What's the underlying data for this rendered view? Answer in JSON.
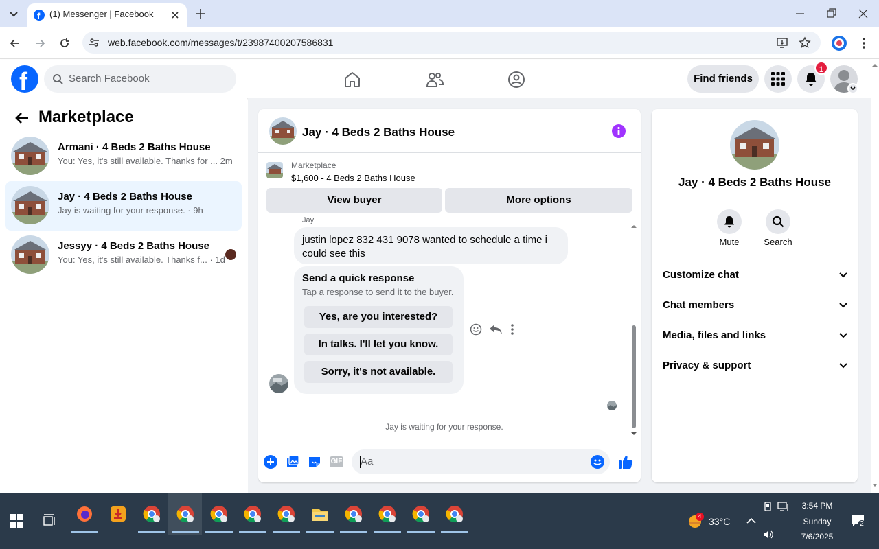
{
  "browser": {
    "tab_title": "(1) Messenger | Facebook",
    "url": "web.facebook.com/messages/t/23987400207586831"
  },
  "fb": {
    "search_placeholder": "Search Facebook",
    "find_friends": "Find friends",
    "notification_count": "1"
  },
  "sidebar": {
    "title": "Marketplace",
    "conversations": [
      {
        "name": "Armani · 4 Beds 2 Baths House",
        "preview": "You: Yes, it's still available. Thanks for ...",
        "time": "2m",
        "selected": false
      },
      {
        "name": "Jay · 4 Beds 2 Baths House",
        "preview": "Jay is waiting for your response. · 9h",
        "time": "",
        "selected": true
      },
      {
        "name": "Jessyy · 4 Beds 2 Baths House",
        "preview": "You: Yes, it's still available. Thanks f... · 1d",
        "time": "",
        "selected": false
      }
    ]
  },
  "chat": {
    "title": "Jay · 4 Beds 2 Baths House",
    "listing_label": "Marketplace",
    "listing_detail": "$1,600 - 4 Beds 2 Baths House",
    "view_buyer": "View buyer",
    "more_options": "More options",
    "sender_label": "Jay",
    "message": "justin lopez 832 431 9078 wanted to schedule a time i could see this",
    "quick_title": "Send a quick response",
    "quick_sub": "Tap a response to send it to the buyer.",
    "quick_options": [
      "Yes, are you interested?",
      "In talks. I'll let you know.",
      "Sorry, it's not available."
    ],
    "waiting": "Jay is waiting for your response.",
    "composer_placeholder": "Aa",
    "gif_label": "GIF"
  },
  "details": {
    "name": "Jay · 4 Beds 2 Baths House",
    "mute": "Mute",
    "search": "Search",
    "sections": [
      "Customize chat",
      "Chat members",
      "Media, files and links",
      "Privacy & support"
    ]
  },
  "taskbar": {
    "weather_temp": "33°C",
    "weather_badge": "4",
    "time": "3:54 PM",
    "day": "Sunday",
    "date": "7/6/2025",
    "notif_count": "2"
  },
  "colors": {
    "fb_blue": "#0866ff",
    "accent_purple": "#a033ff",
    "notif_red": "#e41e3f",
    "selected_bg": "#ebf5ff"
  }
}
